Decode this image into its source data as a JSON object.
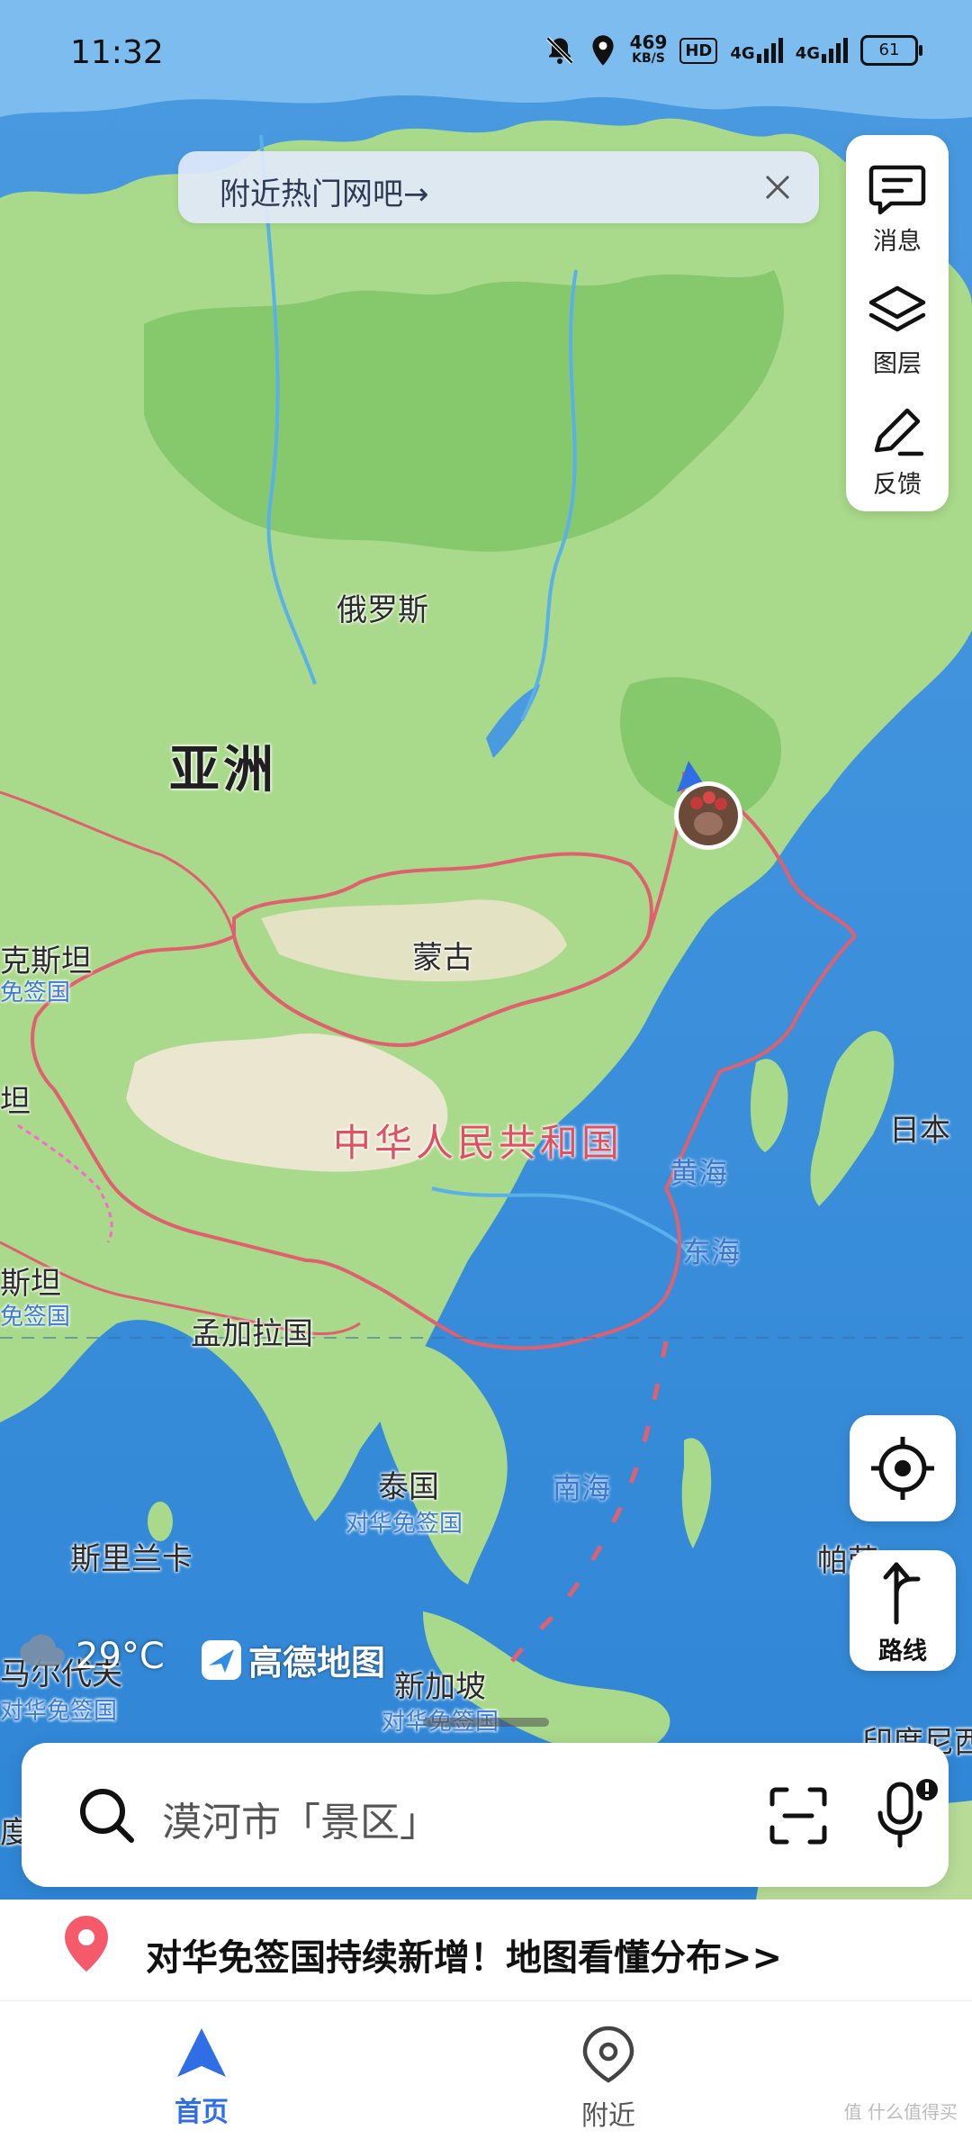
{
  "status_bar": {
    "time": "11:32",
    "speed_value": "469",
    "speed_unit": "KB/S",
    "hd": "HD",
    "net1": "4G",
    "net2": "4G",
    "battery": "61",
    "icons": [
      "mute-bell-icon",
      "location-icon",
      "signal-icon",
      "battery-icon"
    ]
  },
  "banner": {
    "text": "附近热门网吧→",
    "close_icon": "close-icon"
  },
  "tools": [
    {
      "icon": "message-icon",
      "label": "消息"
    },
    {
      "icon": "layers-icon",
      "label": "图层"
    },
    {
      "icon": "feedback-icon",
      "label": "反馈"
    }
  ],
  "map": {
    "labels": {
      "russia": "俄罗斯",
      "asia": "亚洲",
      "mongolia": "蒙古",
      "china": "中华人民共和国",
      "yellow_sea": "黄海",
      "east_sea": "东海",
      "japan": "日本",
      "bangladesh": "孟加拉国",
      "thailand": "泰国",
      "thailand_visa": "对华免签国",
      "south_sea": "南海",
      "sri_lanka": "斯里兰卡",
      "singapore": "新加坡",
      "singapore_visa": "对华免签国",
      "kazakhstan_partial": "克斯坦",
      "kazakhstan_visa_partial": "免签国",
      "pakistan_partial": "斯坦",
      "pakistan_visa_partial": "免签国",
      "tan_partial": "坦",
      "maldives_partial": "马尔代夫",
      "maldives_visa_partial": "对华免签国",
      "pa_partial": "帕劳",
      "indonesia_partial": "印度尼西亚",
      "du_partial": "度"
    },
    "colors": {
      "ocean": "#5aa9e6",
      "land": "#a8d889",
      "forest": "#7fc46a",
      "desert": "#e9e6cc",
      "border": "#e06070"
    }
  },
  "controls": {
    "locate_icon": "locate-icon",
    "route_label": "路线",
    "route_icon": "route-arrow-icon"
  },
  "weather": {
    "temp": "29°C",
    "icon": "cloud-rain-icon"
  },
  "logo": {
    "text": "高德地图",
    "icon": "amap-logo-icon"
  },
  "search": {
    "placeholder": "漠河市「景区」",
    "icons": [
      "search-icon",
      "scan-icon",
      "mic-icon"
    ]
  },
  "promo": {
    "text": "对华免签国持续新增！地图看懂分布>>",
    "icon": "red-pin-icon"
  },
  "nav": {
    "home": "首页",
    "nearby": "附近"
  },
  "watermark": "值 什么值得买"
}
